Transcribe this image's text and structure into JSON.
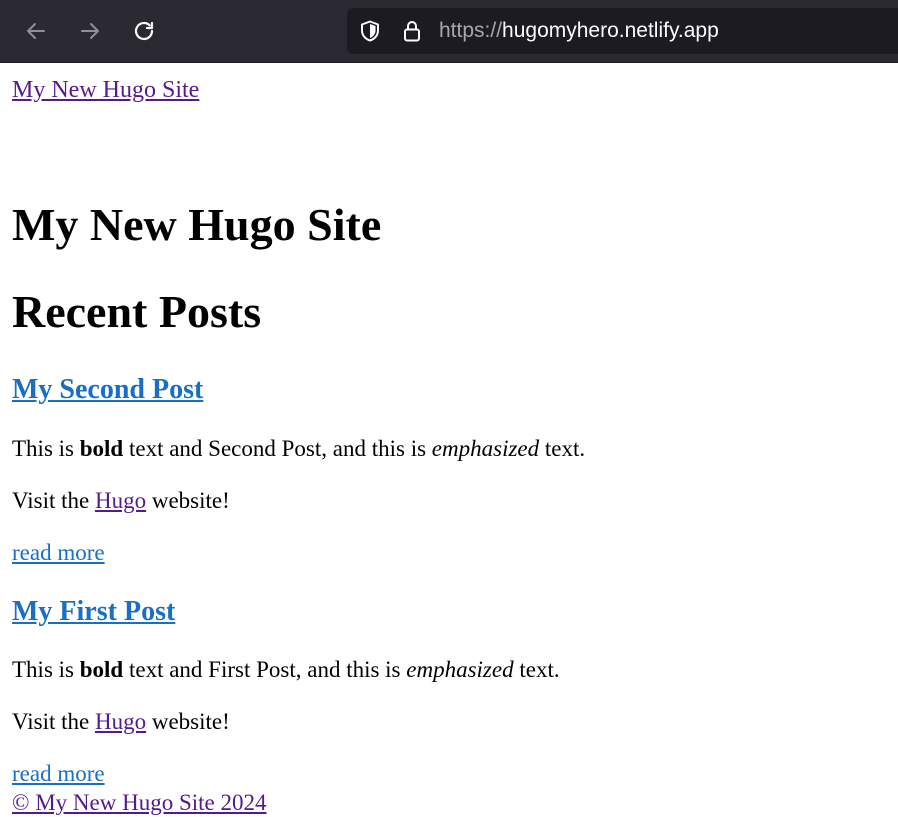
{
  "browser": {
    "url_scheme": "https://",
    "url_host": "hugomyhero.netlify.app"
  },
  "header": {
    "site_link": "My New Hugo Site"
  },
  "main": {
    "title": "My New Hugo Site",
    "section_heading": "Recent Posts",
    "posts": [
      {
        "title": "My Second Post",
        "intro_pre": "This is ",
        "intro_bold": "bold",
        "intro_mid": " text and Second Post, and this is ",
        "intro_em": "emphasized",
        "intro_post": " text.",
        "visit_pre": "Visit the ",
        "visit_link": "Hugo",
        "visit_post": " website!",
        "read_more": "read more"
      },
      {
        "title": "My First Post",
        "intro_pre": "This is ",
        "intro_bold": "bold",
        "intro_mid": " text and First Post, and this is ",
        "intro_em": "emphasized",
        "intro_post": " text.",
        "visit_pre": "Visit the ",
        "visit_link": "Hugo",
        "visit_post": " website!",
        "read_more": "read more"
      }
    ]
  },
  "footer": {
    "copyright": "© My New Hugo Site 2024"
  },
  "icons": {
    "back": "arrow-left-icon",
    "forward": "arrow-right-icon",
    "reload": "reload-icon",
    "shield": "shield-icon",
    "lock": "lock-icon"
  },
  "colors": {
    "toolbar": "#2b2a33",
    "urlbar": "#1c1b22",
    "link_unvisited": "#1a6fc4",
    "link_visited": "#551a8b"
  }
}
